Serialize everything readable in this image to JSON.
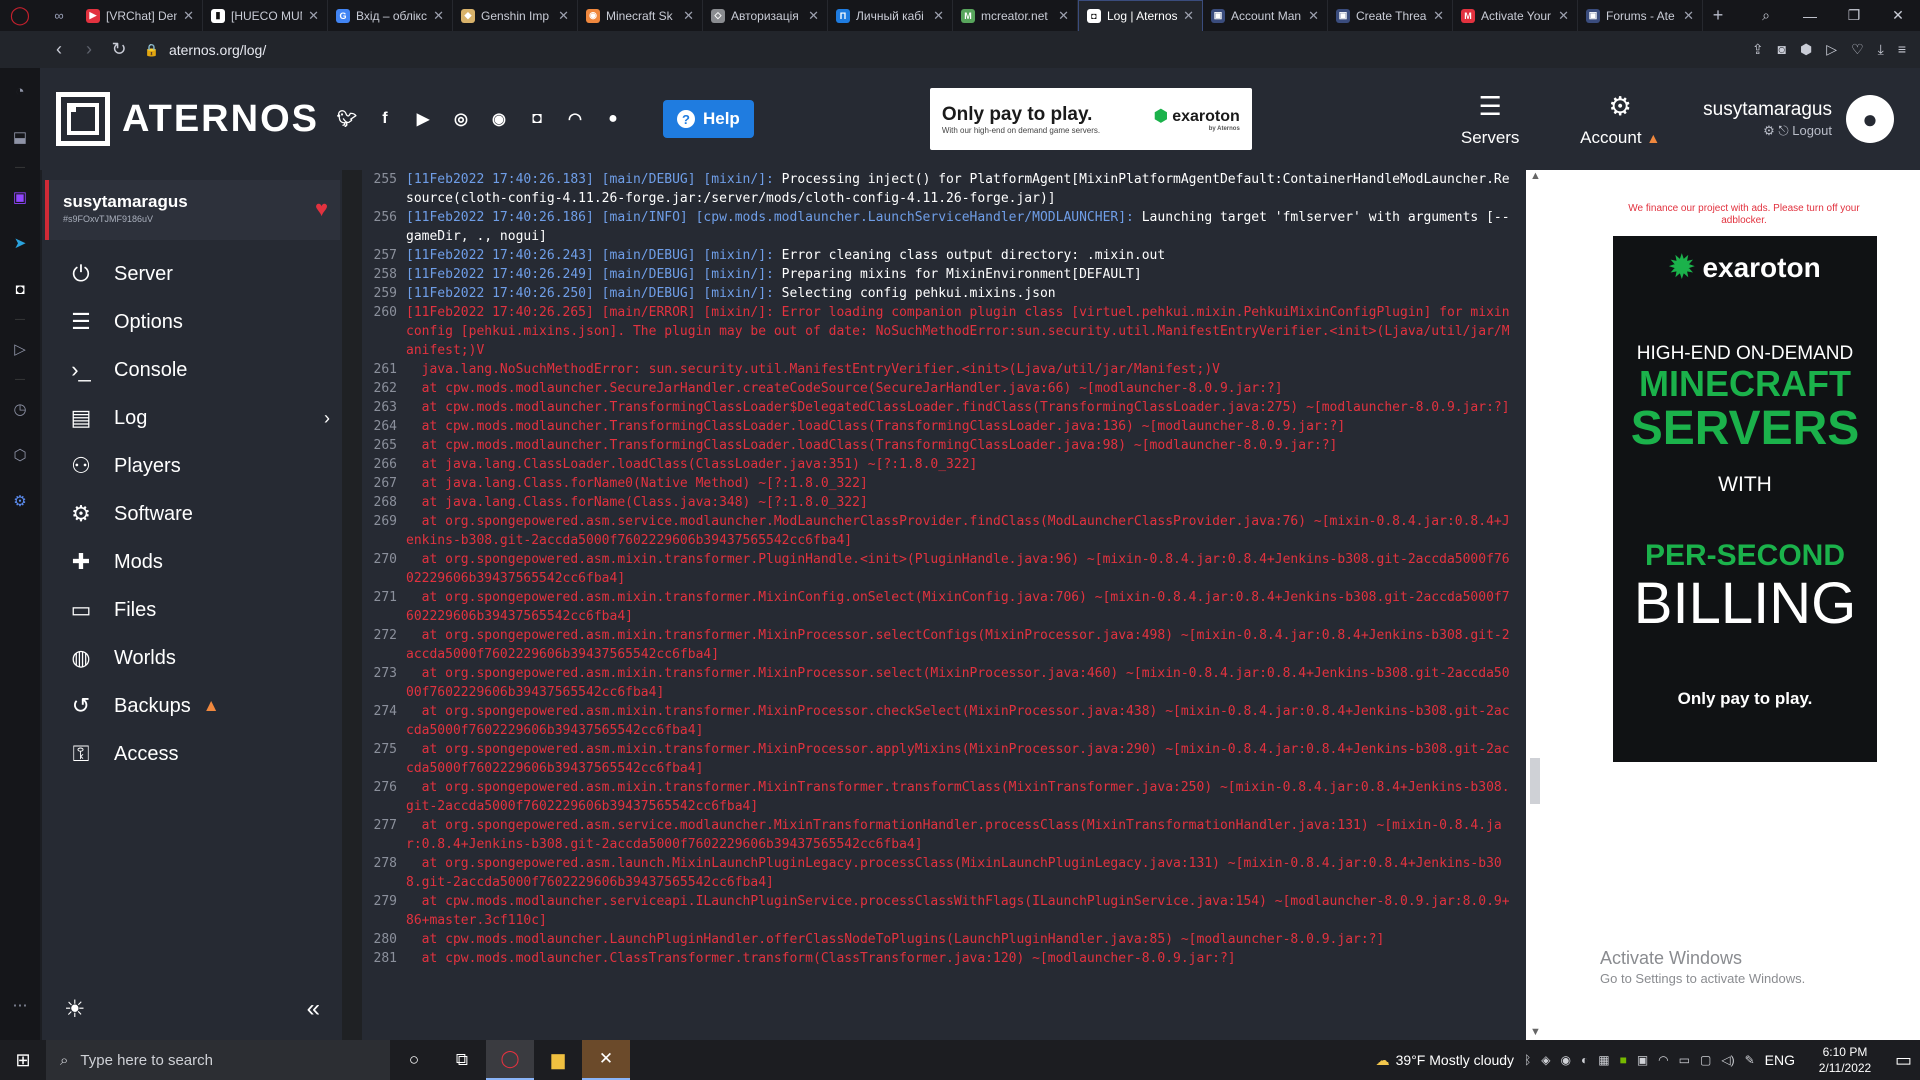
{
  "browser": {
    "tabs": [
      {
        "label": "[VRChat] Den",
        "color": "#e2323f",
        "glyph": "▶"
      },
      {
        "label": "[HUECO MUN",
        "color": "#ffffff",
        "glyph": "▮"
      },
      {
        "label": "Вхід – облікс",
        "color": "#4285f4",
        "glyph": "G"
      },
      {
        "label": "Genshin Imp",
        "color": "#d8b26a",
        "glyph": "◆"
      },
      {
        "label": "Minecraft Sk",
        "color": "#f0883e",
        "glyph": "◉"
      },
      {
        "label": "Авторизація",
        "color": "#8a8c90",
        "glyph": "◇"
      },
      {
        "label": "Личный кабі",
        "color": "#1f7ce0",
        "glyph": "П"
      },
      {
        "label": "mcreator.net",
        "color": "#58a55c",
        "glyph": "M"
      },
      {
        "label": "Log | Aternos",
        "color": "#ffffff",
        "glyph": "◘",
        "active": true
      },
      {
        "label": "Account Man",
        "color": "#3a4c7d",
        "glyph": "▣"
      },
      {
        "label": "Create Threa",
        "color": "#3a4c7d",
        "glyph": "▣"
      },
      {
        "label": "Activate Your",
        "color": "#e2323f",
        "glyph": "M"
      },
      {
        "label": "Forums - Ate",
        "color": "#3a4c7d",
        "glyph": "▣"
      }
    ],
    "url": "aternos.org/log/"
  },
  "header": {
    "brand": "ATERNOS",
    "help_label": "Help",
    "ad_headline": "Only pay to play.",
    "ad_sub": "With our high-end on demand game servers.",
    "ad_brand": "exaroton",
    "ad_brand_sub": "by Aternos",
    "servers_label": "Servers",
    "account_label": "Account",
    "username": "susytamaragus",
    "logout_label": "Logout"
  },
  "sidebar": {
    "server_name": "susytamaragus",
    "server_id": "#s9FOxvTJMF9186uV",
    "items": [
      {
        "label": "Server",
        "icon": "⏻"
      },
      {
        "label": "Options",
        "icon": "☰"
      },
      {
        "label": "Console",
        "icon": "›_"
      },
      {
        "label": "Log",
        "icon": "▤"
      },
      {
        "label": "Players",
        "icon": "⚇"
      },
      {
        "label": "Software",
        "icon": "⚙"
      },
      {
        "label": "Mods",
        "icon": "✚"
      },
      {
        "label": "Files",
        "icon": "▭"
      },
      {
        "label": "Worlds",
        "icon": "◍"
      },
      {
        "label": "Backups",
        "icon": "↺"
      },
      {
        "label": "Access",
        "icon": "⚿"
      }
    ]
  },
  "log": [
    {
      "n": "255",
      "ts": "[11Feb2022 17:40:26.183] [main/DEBUG] [mixin/]:",
      "msg": " Processing inject() for PlatformAgent[MixinPlatformAgentDefault:ContainerHandleModLauncher.Resource(cloth-config-4.11.26-forge.jar:/server/mods/cloth-config-4.11.26-forge.jar)]",
      "type": "info"
    },
    {
      "n": "256",
      "ts": "[11Feb2022 17:40:26.186] [main/INFO] [cpw.mods.modlauncher.LaunchServiceHandler/MODLAUNCHER]:",
      "msg": " Launching target 'fmlserver' with arguments [--gameDir, ., nogui]",
      "type": "info"
    },
    {
      "n": "257",
      "ts": "[11Feb2022 17:40:26.243] [main/DEBUG] [mixin/]:",
      "msg": " Error cleaning class output directory: .mixin.out",
      "type": "info"
    },
    {
      "n": "258",
      "ts": "[11Feb2022 17:40:26.249] [main/DEBUG] [mixin/]:",
      "msg": " Preparing mixins for MixinEnvironment[DEFAULT]",
      "type": "info"
    },
    {
      "n": "259",
      "ts": "[11Feb2022 17:40:26.250] [main/DEBUG] [mixin/]:",
      "msg": " Selecting config pehkui.mixins.json",
      "type": "info"
    },
    {
      "n": "260",
      "ts": "[11Feb2022 17:40:26.265] [main/ERROR] [mixin/]:",
      "msg": " Error loading companion plugin class [virtuel.pehkui.mixin.PehkuiMixinConfigPlugin] for mixin config [pehkui.mixins.json]. The plugin may be out of date: NoSuchMethodError:sun.security.util.ManifestEntryVerifier.<init>(Ljava/util/jar/Manifest;)V",
      "type": "error"
    },
    {
      "n": "261",
      "ts": "",
      "msg": "  java.lang.NoSuchMethodError: sun.security.util.ManifestEntryVerifier.<init>(Ljava/util/jar/Manifest;)V",
      "type": "error"
    },
    {
      "n": "262",
      "ts": "",
      "msg": "  at cpw.mods.modlauncher.SecureJarHandler.createCodeSource(SecureJarHandler.java:66) ~[modlauncher-8.0.9.jar:?]",
      "type": "error"
    },
    {
      "n": "263",
      "ts": "",
      "msg": "  at cpw.mods.modlauncher.TransformingClassLoader$DelegatedClassLoader.findClass(TransformingClassLoader.java:275) ~[modlauncher-8.0.9.jar:?]",
      "type": "error"
    },
    {
      "n": "264",
      "ts": "",
      "msg": "  at cpw.mods.modlauncher.TransformingClassLoader.loadClass(TransformingClassLoader.java:136) ~[modlauncher-8.0.9.jar:?]",
      "type": "error"
    },
    {
      "n": "265",
      "ts": "",
      "msg": "  at cpw.mods.modlauncher.TransformingClassLoader.loadClass(TransformingClassLoader.java:98) ~[modlauncher-8.0.9.jar:?]",
      "type": "error"
    },
    {
      "n": "266",
      "ts": "",
      "msg": "  at java.lang.ClassLoader.loadClass(ClassLoader.java:351) ~[?:1.8.0_322]",
      "type": "error"
    },
    {
      "n": "267",
      "ts": "",
      "msg": "  at java.lang.Class.forName0(Native Method) ~[?:1.8.0_322]",
      "type": "error"
    },
    {
      "n": "268",
      "ts": "",
      "msg": "  at java.lang.Class.forName(Class.java:348) ~[?:1.8.0_322]",
      "type": "error"
    },
    {
      "n": "269",
      "ts": "",
      "msg": "  at org.spongepowered.asm.service.modlauncher.ModLauncherClassProvider.findClass(ModLauncherClassProvider.java:76) ~[mixin-0.8.4.jar:0.8.4+Jenkins-b308.git-2accda5000f7602229606b39437565542cc6fba4]",
      "type": "error"
    },
    {
      "n": "270",
      "ts": "",
      "msg": "  at org.spongepowered.asm.mixin.transformer.PluginHandle.<init>(PluginHandle.java:96) ~[mixin-0.8.4.jar:0.8.4+Jenkins-b308.git-2accda5000f7602229606b39437565542cc6fba4]",
      "type": "error"
    },
    {
      "n": "271",
      "ts": "",
      "msg": "  at org.spongepowered.asm.mixin.transformer.MixinConfig.onSelect(MixinConfig.java:706) ~[mixin-0.8.4.jar:0.8.4+Jenkins-b308.git-2accda5000f7602229606b39437565542cc6fba4]",
      "type": "error"
    },
    {
      "n": "272",
      "ts": "",
      "msg": "  at org.spongepowered.asm.mixin.transformer.MixinProcessor.selectConfigs(MixinProcessor.java:498) ~[mixin-0.8.4.jar:0.8.4+Jenkins-b308.git-2accda5000f7602229606b39437565542cc6fba4]",
      "type": "error"
    },
    {
      "n": "273",
      "ts": "",
      "msg": "  at org.spongepowered.asm.mixin.transformer.MixinProcessor.select(MixinProcessor.java:460) ~[mixin-0.8.4.jar:0.8.4+Jenkins-b308.git-2accda5000f7602229606b39437565542cc6fba4]",
      "type": "error"
    },
    {
      "n": "274",
      "ts": "",
      "msg": "  at org.spongepowered.asm.mixin.transformer.MixinProcessor.checkSelect(MixinProcessor.java:438) ~[mixin-0.8.4.jar:0.8.4+Jenkins-b308.git-2accda5000f7602229606b39437565542cc6fba4]",
      "type": "error"
    },
    {
      "n": "275",
      "ts": "",
      "msg": "  at org.spongepowered.asm.mixin.transformer.MixinProcessor.applyMixins(MixinProcessor.java:290) ~[mixin-0.8.4.jar:0.8.4+Jenkins-b308.git-2accda5000f7602229606b39437565542cc6fba4]",
      "type": "error"
    },
    {
      "n": "276",
      "ts": "",
      "msg": "  at org.spongepowered.asm.mixin.transformer.MixinTransformer.transformClass(MixinTransformer.java:250) ~[mixin-0.8.4.jar:0.8.4+Jenkins-b308.git-2accda5000f7602229606b39437565542cc6fba4]",
      "type": "error"
    },
    {
      "n": "277",
      "ts": "",
      "msg": "  at org.spongepowered.asm.service.modlauncher.MixinTransformationHandler.processClass(MixinTransformationHandler.java:131) ~[mixin-0.8.4.jar:0.8.4+Jenkins-b308.git-2accda5000f7602229606b39437565542cc6fba4]",
      "type": "error"
    },
    {
      "n": "278",
      "ts": "",
      "msg": "  at org.spongepowered.asm.launch.MixinLaunchPluginLegacy.processClass(MixinLaunchPluginLegacy.java:131) ~[mixin-0.8.4.jar:0.8.4+Jenkins-b308.git-2accda5000f7602229606b39437565542cc6fba4]",
      "type": "error"
    },
    {
      "n": "279",
      "ts": "",
      "msg": "  at cpw.mods.modlauncher.serviceapi.ILaunchPluginService.processClassWithFlags(ILaunchPluginService.java:154) ~[modlauncher-8.0.9.jar:8.0.9+86+master.3cf110c]",
      "type": "error"
    },
    {
      "n": "280",
      "ts": "",
      "msg": "  at cpw.mods.modlauncher.LaunchPluginHandler.offerClassNodeToPlugins(LaunchPluginHandler.java:85) ~[modlauncher-8.0.9.jar:?]",
      "type": "error"
    },
    {
      "n": "281",
      "ts": "",
      "msg": "  at cpw.mods.modlauncher.ClassTransformer.transform(ClassTransformer.java:120) ~[modlauncher-8.0.9.jar:?]",
      "type": "error"
    }
  ],
  "ad": {
    "note": "We finance our project with ads. Please turn off your adblocker.",
    "brand": "exaroton",
    "l1": "HIGH-END ON-DEMAND",
    "l2": "MINECRAFT",
    "l3": "SERVERS",
    "l4": "WITH",
    "l5": "PER-SECOND",
    "l6": "BILLING",
    "l7": "Only pay to play."
  },
  "watermark": {
    "title": "Activate Windows",
    "sub": "Go to Settings to activate Windows."
  },
  "taskbar": {
    "search_placeholder": "Type here to search",
    "weather": "39°F  Mostly cloudy",
    "lang": "ENG",
    "time": "6:10 PM",
    "date": "2/11/2022"
  },
  "colors": {
    "accent": "#1f7ce0",
    "error": "#e2323f",
    "warning": "#f0883e",
    "green": "#1bb24b"
  }
}
